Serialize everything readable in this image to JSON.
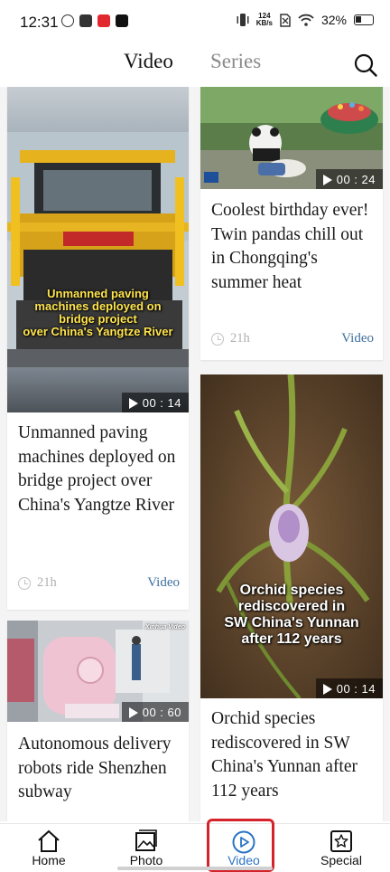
{
  "status_bar": {
    "time": "12:31",
    "net_speed_value": "124",
    "net_speed_unit": "KB/s",
    "battery": "32%"
  },
  "tabs": {
    "video": "Video",
    "series": "Series"
  },
  "cards": [
    {
      "overlay": "Unmanned paving machines deployed on bridge project over China's Yangtze River",
      "overlay_lines": [
        "Unmanned paving",
        "machines deployed on",
        "bridge project",
        "over China's Yangtze River"
      ],
      "duration": "00 : 14",
      "title": "Unmanned paving machines deployed on bridge project over China's Yangtze River",
      "time_ago": "21h",
      "tag": "Video"
    },
    {
      "watermark": "Xinhua Video",
      "duration": "00 : 60",
      "title": "Autonomous delivery robots ride Shenzhen subway"
    },
    {
      "duration": "00 : 24",
      "title": "Coolest birthday ever! Twin pandas chill out in Chongqing's summer heat",
      "time_ago": "21h",
      "tag": "Video"
    },
    {
      "overlay_lines": [
        "Orchid species",
        "rediscovered in",
        "SW China's Yunnan",
        "after 112 years"
      ],
      "duration": "00 : 14",
      "title": "Orchid species rediscovered in SW China's Yunnan after 112 years"
    }
  ],
  "bottom_nav": [
    {
      "label": "Home",
      "icon": "home-icon"
    },
    {
      "label": "Photo",
      "icon": "photo-icon"
    },
    {
      "label": "Video",
      "icon": "video-play-icon",
      "active": true
    },
    {
      "label": "Special",
      "icon": "star-icon"
    }
  ],
  "colors": {
    "accent": "#2b74c4",
    "tag": "#3d6f9e",
    "highlight_frame": "#d4232b"
  }
}
